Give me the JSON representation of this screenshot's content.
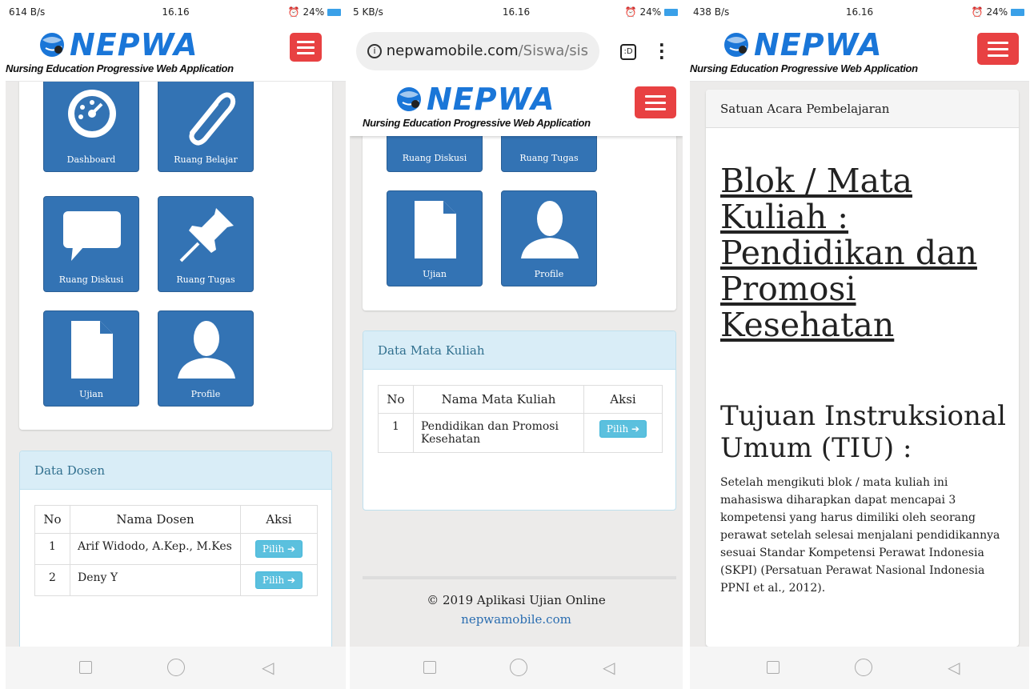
{
  "app": {
    "brand": "NEPWA",
    "tagline": "Nursing Education Progressive Web Application",
    "accent_color": "#1a76d8",
    "menu_color": "#e84142",
    "tile_color": "#3373b4"
  },
  "screens": [
    {
      "status": {
        "left": "614 B/s",
        "time": "16.16",
        "right": "24%"
      },
      "tiles": [
        {
          "label": "Dashboard",
          "icon": "dashboard-gauge-icon"
        },
        {
          "label": "Ruang Belajar",
          "icon": "paperclip-icon"
        },
        {
          "label": "Ruang Diskusi",
          "icon": "speech-bubble-icon"
        },
        {
          "label": "Ruang Tugas",
          "icon": "pushpin-icon"
        },
        {
          "label": "Ujian",
          "icon": "document-icon"
        },
        {
          "label": "Profile",
          "icon": "user-silhouette-icon"
        }
      ],
      "panel": {
        "title": "Data Dosen",
        "columns": [
          "No",
          "Nama Dosen",
          "Aksi"
        ],
        "rows": [
          {
            "no": "1",
            "name": "Arif Widodo, A.Kep., M.Kes",
            "action": "Pilih"
          },
          {
            "no": "2",
            "name": "Deny Y",
            "action": "Pilih"
          }
        ]
      }
    },
    {
      "status": {
        "left": "5 KB/s",
        "time": "16.16",
        "right": "24%"
      },
      "url": {
        "host": "nepwamobile.com",
        "path": "/Siswa/sis"
      },
      "tiles": [
        {
          "label": "Ruang Diskusi",
          "icon": "speech-bubble-icon"
        },
        {
          "label": "Ruang Tugas",
          "icon": "pushpin-icon"
        },
        {
          "label": "Ujian",
          "icon": "document-icon"
        },
        {
          "label": "Profile",
          "icon": "user-silhouette-icon"
        }
      ],
      "panel": {
        "title": "Data Mata Kuliah",
        "columns": [
          "No",
          "Nama Mata Kuliah",
          "Aksi"
        ],
        "rows": [
          {
            "no": "1",
            "name": "Pendidikan dan Promosi Kesehatan",
            "action": "Pilih"
          }
        ]
      },
      "footer": {
        "copyright": "© 2019 Aplikasi Ujian Online",
        "link": "nepwamobile.com"
      }
    },
    {
      "status": {
        "left": "438 B/s",
        "time": "16.16",
        "right": "24%"
      },
      "card_title": "Satuan Acara Pembelajaran",
      "heading": "Blok / Mata Kuliah : Pendidikan dan Promosi Kesehatan",
      "subheading": "Tujuan Instruksional Umum (TIU) :",
      "body": "Setelah mengikuti blok / mata kuliah ini mahasiswa diharapkan dapat mencapai 3 kompetensi yang harus dimiliki oleh seorang perawat setelah selesai menjalani pendidikannya sesuai Standar Kompetensi Perawat Indonesia (SKPI) (Persatuan Perawat Nasional Indonesia PPNI et al., 2012)."
    }
  ]
}
